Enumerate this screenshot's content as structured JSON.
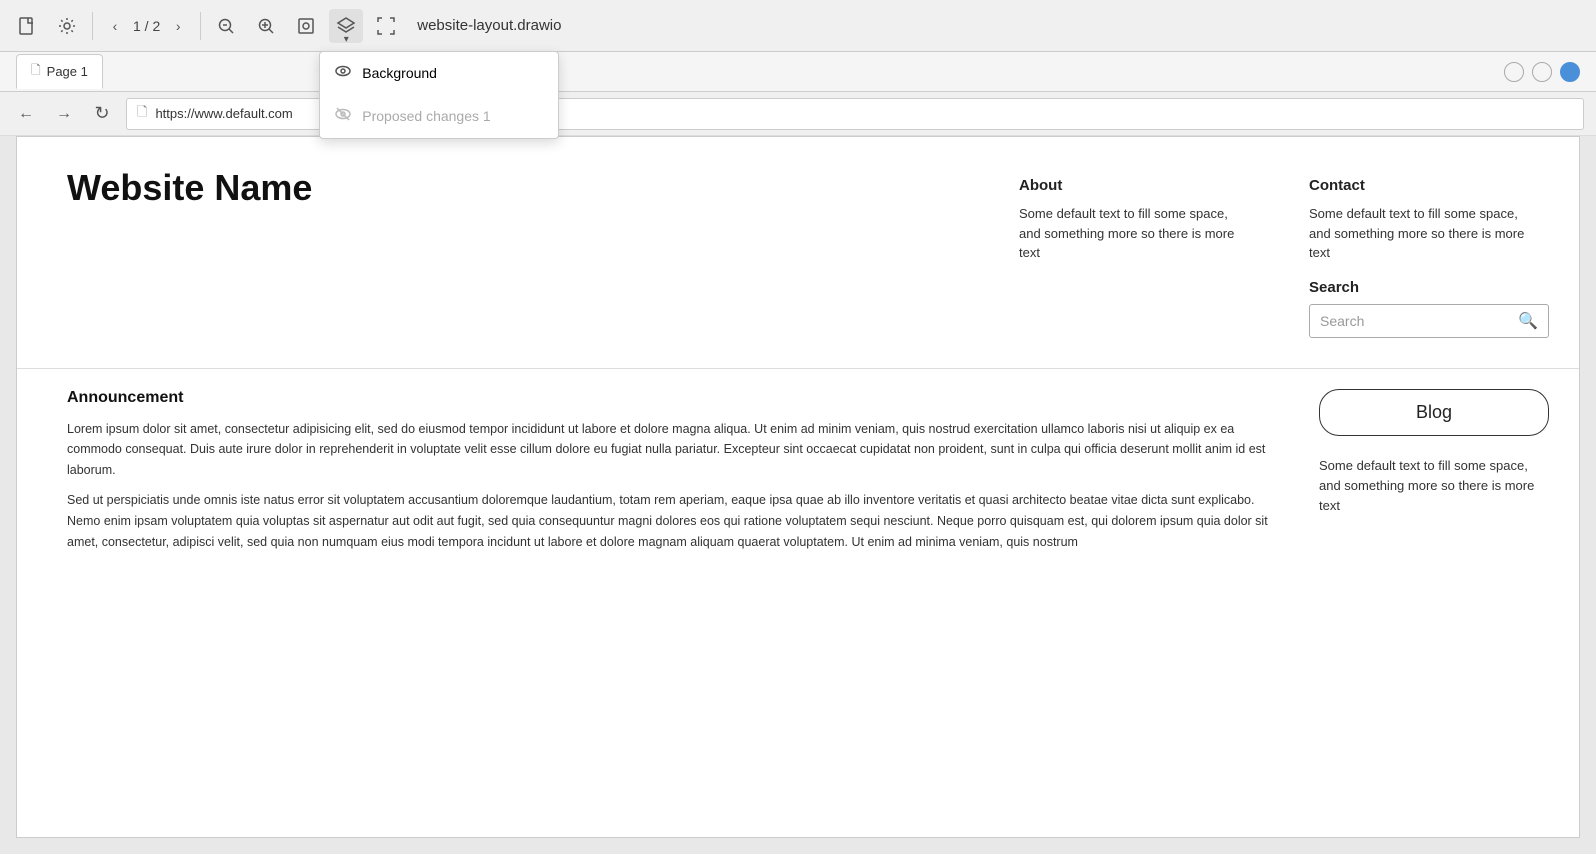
{
  "toolbar": {
    "new_icon": "🗋",
    "settings_icon": "⚙",
    "page_label": "1 / 2",
    "zoom_out_icon": "🔍",
    "zoom_in_icon": "🔍",
    "fit_icon": "⊞",
    "layers_icon": "◈",
    "fullscreen_icon": "⛶",
    "file_title": "website-layout.drawio"
  },
  "layers_dropdown": {
    "items": [
      {
        "id": "background",
        "label": "Background",
        "icon": "👁",
        "enabled": true
      },
      {
        "id": "proposed_changes",
        "label": "Proposed changes 1",
        "icon": "👁",
        "enabled": false
      }
    ]
  },
  "tabs": [
    {
      "id": "page1",
      "label": "Page 1",
      "active": true
    }
  ],
  "window_controls": {
    "close": "○",
    "minimize": "○",
    "maximize": "●"
  },
  "browser": {
    "back_icon": "←",
    "forward_icon": "→",
    "refresh_icon": "↻",
    "page_icon": "🗋",
    "address": "https://www.default.com"
  },
  "site": {
    "name": "Website Name",
    "about_title": "About",
    "about_text": "Some default text to fill some space, and something more so there is more text",
    "contact_title": "Contact",
    "contact_text": "Some default text to fill some space, and something more so there is more text",
    "search_title": "Search",
    "search_placeholder": "Search",
    "announcement_title": "Announcement",
    "announcement_text_1": "Lorem ipsum dolor sit amet, consectetur adipisicing elit, sed do eiusmod tempor incididunt ut labore et dolore magna aliqua. Ut enim ad minim veniam, quis nostrud exercitation ullamco laboris nisi ut aliquip ex ea commodo consequat. Duis aute irure dolor in reprehenderit in voluptate velit esse cillum dolore eu fugiat nulla pariatur. Excepteur sint occaecat cupidatat non proident, sunt in culpa qui officia deserunt mollit anim id est laborum.",
    "announcement_text_2": "Sed ut perspiciatis unde omnis iste natus error sit voluptatem accusantium doloremque laudantium, totam rem aperiam, eaque ipsa quae ab illo inventore veritatis et quasi architecto beatae vitae dicta sunt explicabo. Nemo enim ipsam voluptatem quia voluptas sit aspernatur aut odit aut fugit, sed quia consequuntur magni dolores eos qui ratione voluptatem sequi nesciunt. Neque porro quisquam est, qui dolorem ipsum quia dolor sit amet, consectetur, adipisci velit, sed quia non numquam eius modi tempora incidunt ut labore et dolore magnam aliquam quaerat voluptatem. Ut enim ad minima veniam, quis nostrum",
    "blog_label": "Blog",
    "sidebar_text": "Some default text to fill some space, and something more so there is more text"
  }
}
